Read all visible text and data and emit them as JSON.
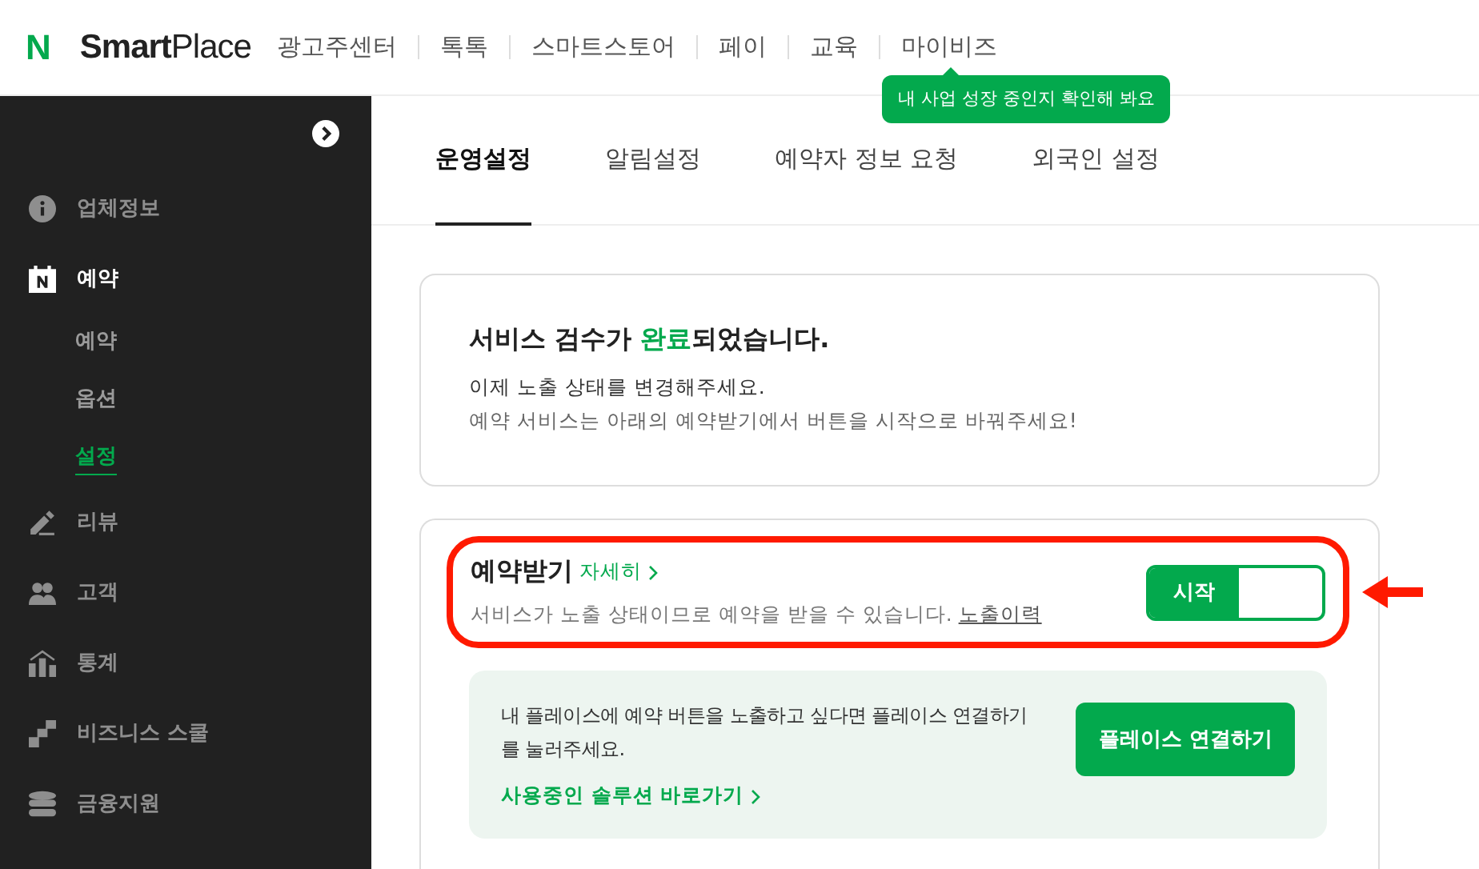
{
  "header": {
    "logo_mark": "N",
    "logo_text_bold": "Smart",
    "logo_text": "Place",
    "nav": [
      "광고주센터",
      "톡톡",
      "스마트스토어",
      "페이",
      "교육",
      "마이비즈"
    ],
    "tooltip": "내 사업 성장 중인지 확인해 봐요"
  },
  "sidebar": {
    "items": [
      {
        "label": "업체정보",
        "selected": false
      },
      {
        "label": "예약",
        "selected": true,
        "children": [
          {
            "label": "예약",
            "selected": false
          },
          {
            "label": "옵션",
            "selected": false
          },
          {
            "label": "설정",
            "selected": true
          }
        ]
      },
      {
        "label": "리뷰",
        "selected": false
      },
      {
        "label": "고객",
        "selected": false
      },
      {
        "label": "통계",
        "selected": false
      },
      {
        "label": "비즈니스 스쿨",
        "selected": false
      },
      {
        "label": "금융지원",
        "selected": false
      }
    ]
  },
  "tabs": [
    {
      "label": "운영설정",
      "selected": true
    },
    {
      "label": "알림설정",
      "selected": false
    },
    {
      "label": "예약자 정보 요청",
      "selected": false
    },
    {
      "label": "외국인 설정",
      "selected": false
    }
  ],
  "notice": {
    "title": "서비스 검수가 **완료**되었습니다.",
    "line_1": "이제 노출 상태를 변경해주세요.",
    "line_2": "예약 서비스는 아래의 예약받기에서 버튼을 시작으로 바꿔주세요!"
  },
  "booking": {
    "title": "예약받기",
    "detail_link": "자세히",
    "description": "서비스가 노출 상태이므로 예약을 받을 수 있습니다.",
    "history_link": "노출이력",
    "toggle": {
      "label": "시작",
      "on": true
    },
    "highlighted": true
  },
  "place_box": {
    "text": "내 플레이스에 예약 버튼을 노출하고 싶다면 플레이스 연결하기를 눌러주세요.",
    "link": "사용중인 솔루션 바로가기",
    "button": "플레이스 연결하기"
  }
}
